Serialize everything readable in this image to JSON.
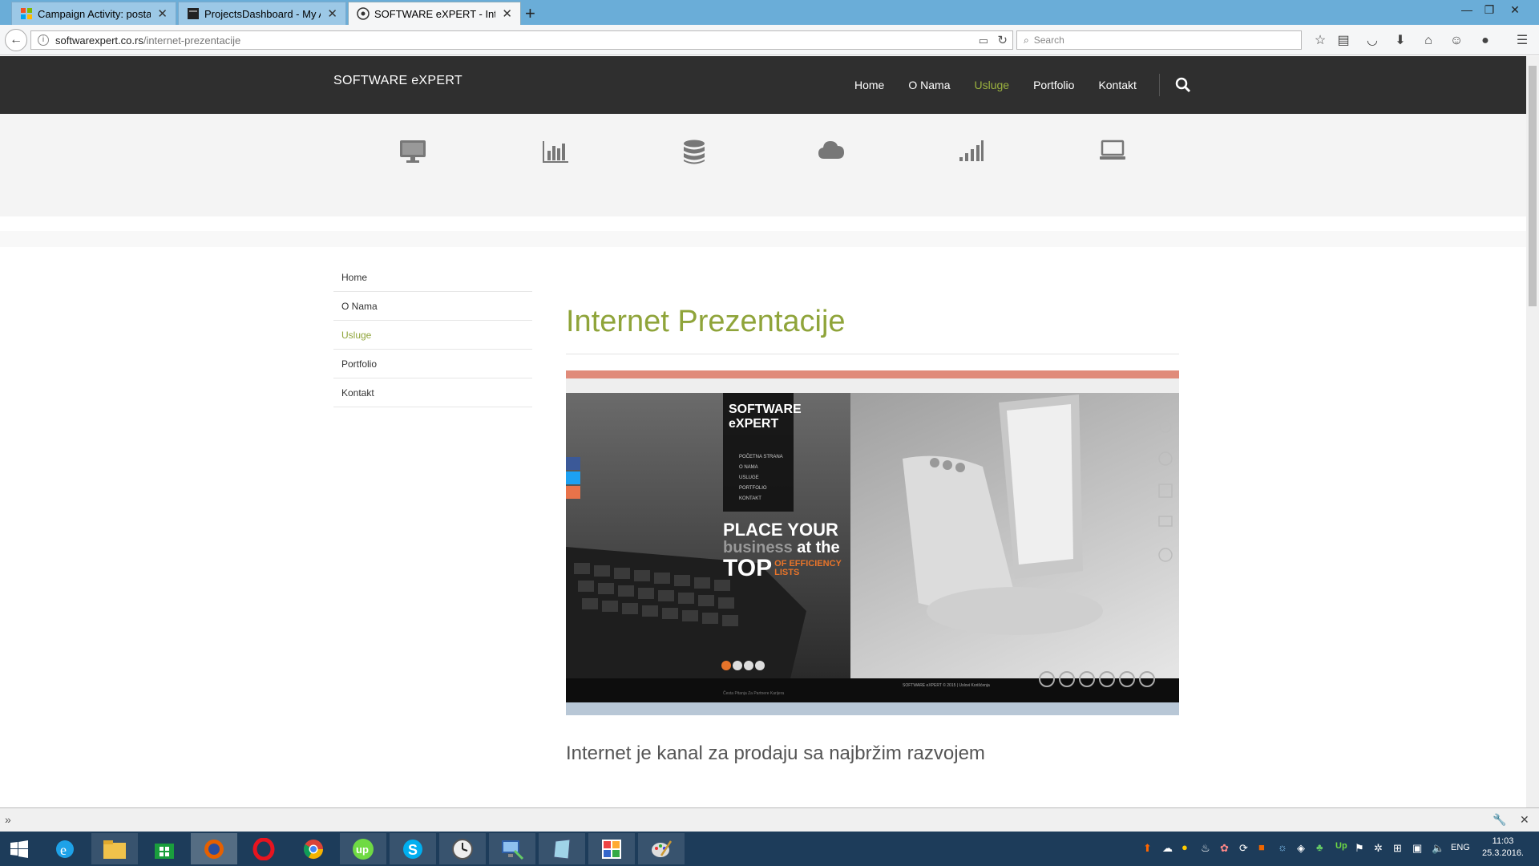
{
  "browser": {
    "tabs": [
      {
        "title": "Campaign Activity: postav...",
        "active": false
      },
      {
        "title": "ProjectsDashboard - My A...",
        "active": false
      },
      {
        "title": "SOFTWARE eXPERT - Inter...",
        "active": true
      }
    ],
    "url_host": "softwarexpert.co.rs",
    "url_path": "/internet-prezentacije",
    "search_placeholder": "Search"
  },
  "site": {
    "logo": "SOFTWARE eXPERT",
    "menu": [
      {
        "label": "Home",
        "active": false
      },
      {
        "label": "O Nama",
        "active": false
      },
      {
        "label": "Usluge",
        "active": true
      },
      {
        "label": "Portfolio",
        "active": false
      },
      {
        "label": "Kontakt",
        "active": false
      }
    ],
    "service_icons": [
      "monitor-icon",
      "bar-chart-icon",
      "database-icon",
      "cloud-icon",
      "signal-icon",
      "laptop-icon"
    ],
    "sidenav": [
      {
        "label": "Home",
        "active": false
      },
      {
        "label": "O Nama",
        "active": false
      },
      {
        "label": "Usluge",
        "active": true
      },
      {
        "label": "Portfolio",
        "active": false
      },
      {
        "label": "Kontakt",
        "active": false
      }
    ],
    "accent": "#8fa43a"
  },
  "content": {
    "title": "Internet Prezentacije",
    "subtitle": "Internet je kanal za prodaju sa najbržim razvojem",
    "screenshot": {
      "logo_line1": "SOFTWARE",
      "logo_line2": "eXPERT",
      "menu": [
        "POČETNA STRANA",
        "O NAMA",
        "USLUGE",
        "PORTFOLIO",
        "KONTAKT"
      ],
      "headline_1": "PLACE YOUR",
      "headline_2a": "business",
      "headline_2b": "at the",
      "headline_3a": "TOP",
      "headline_3b": "OF EFFICIENCY",
      "headline_3c": "LISTS",
      "footer": "SOFTWARE eXPERT © 2015 | Uslovi Korišćenja",
      "footer_links": "Česta Pitanja   Za Partnere   Karijera"
    }
  },
  "taskbar": {
    "language": "ENG",
    "time": "11:03",
    "date": "25.3.2016."
  }
}
